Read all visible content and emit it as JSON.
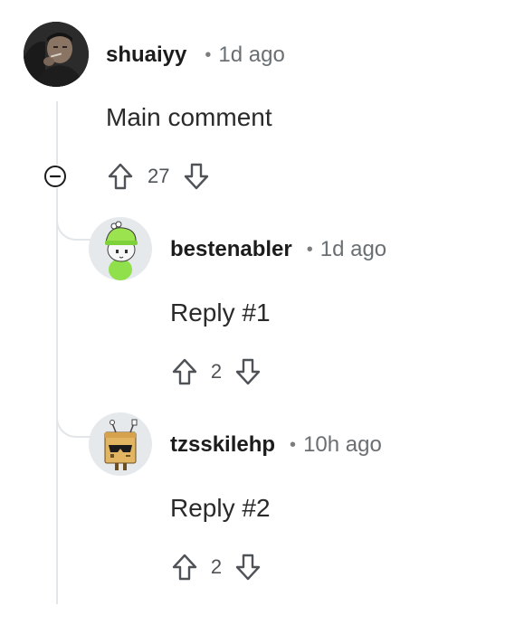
{
  "comment": {
    "author": "shuaiyy",
    "time_separator": "•",
    "time": "1d ago",
    "body": "Main comment",
    "votes": "27",
    "avatar": "user-photo-avatar",
    "replies": [
      {
        "author": "bestenabler",
        "time_separator": "•",
        "time": "1d ago",
        "body": "Reply #1",
        "votes": "2",
        "avatar": "green-hat-cartoon-avatar"
      },
      {
        "author": "tzsskilehp",
        "time_separator": "•",
        "time": "10h ago",
        "body": "Reply #2",
        "votes": "2",
        "avatar": "box-robot-cartoon-avatar"
      }
    ]
  },
  "icons": {
    "collapse": "minus-circle-icon",
    "upvote": "arrow-up-icon",
    "downvote": "arrow-down-icon"
  },
  "colors": {
    "thread_line": "#e3e6e8",
    "text": "#1c1c1c",
    "meta": "#6a6f73"
  }
}
